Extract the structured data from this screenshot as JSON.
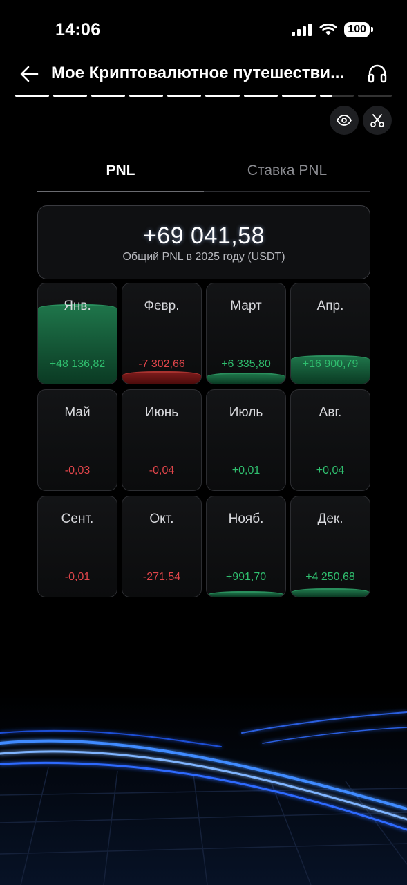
{
  "status_bar": {
    "time": "14:06",
    "battery": "100"
  },
  "header": {
    "title": "Мое Криптовалютное путешестви..."
  },
  "story_progress": [
    1,
    1,
    1,
    1,
    1,
    1,
    1,
    1,
    0.35,
    0
  ],
  "tabs": [
    {
      "label": "PNL",
      "active": true
    },
    {
      "label": "Ставка PNL",
      "active": false
    }
  ],
  "summary": {
    "value": "+69 041,58",
    "label": "Общий PNL в 2025 году (USDT)"
  },
  "months": [
    {
      "name": "Янв.",
      "value": "+48 136,82",
      "sign": "pos",
      "level": 0.78
    },
    {
      "name": "Февр.",
      "value": "-7 302,66",
      "sign": "neg",
      "level": 0.11
    },
    {
      "name": "Март",
      "value": "+6 335,80",
      "sign": "pos",
      "level": 0.1
    },
    {
      "name": "Апр.",
      "value": "+16 900,79",
      "sign": "pos",
      "level": 0.27
    },
    {
      "name": "Май",
      "value": "-0,03",
      "sign": "neg",
      "level": 0
    },
    {
      "name": "Июнь",
      "value": "-0,04",
      "sign": "neg",
      "level": 0
    },
    {
      "name": "Июль",
      "value": "+0,01",
      "sign": "pos",
      "level": 0
    },
    {
      "name": "Авг.",
      "value": "+0,04",
      "sign": "pos",
      "level": 0
    },
    {
      "name": "Сент.",
      "value": "-0,01",
      "sign": "neg",
      "level": 0
    },
    {
      "name": "Окт.",
      "value": "-271,54",
      "sign": "neg",
      "level": 0
    },
    {
      "name": "Нояб.",
      "value": "+991,70",
      "sign": "pos",
      "level": 0.02
    },
    {
      "name": "Дек.",
      "value": "+4 250,68",
      "sign": "pos",
      "level": 0.07
    }
  ],
  "colors": {
    "positive": "#2fbe6e",
    "negative": "#e0454a",
    "accent_glow": "#3a7bff"
  },
  "icons": [
    "back-arrow-icon",
    "headphones-icon",
    "eye-icon",
    "scissors-icon",
    "signal-icon",
    "wifi-icon"
  ]
}
